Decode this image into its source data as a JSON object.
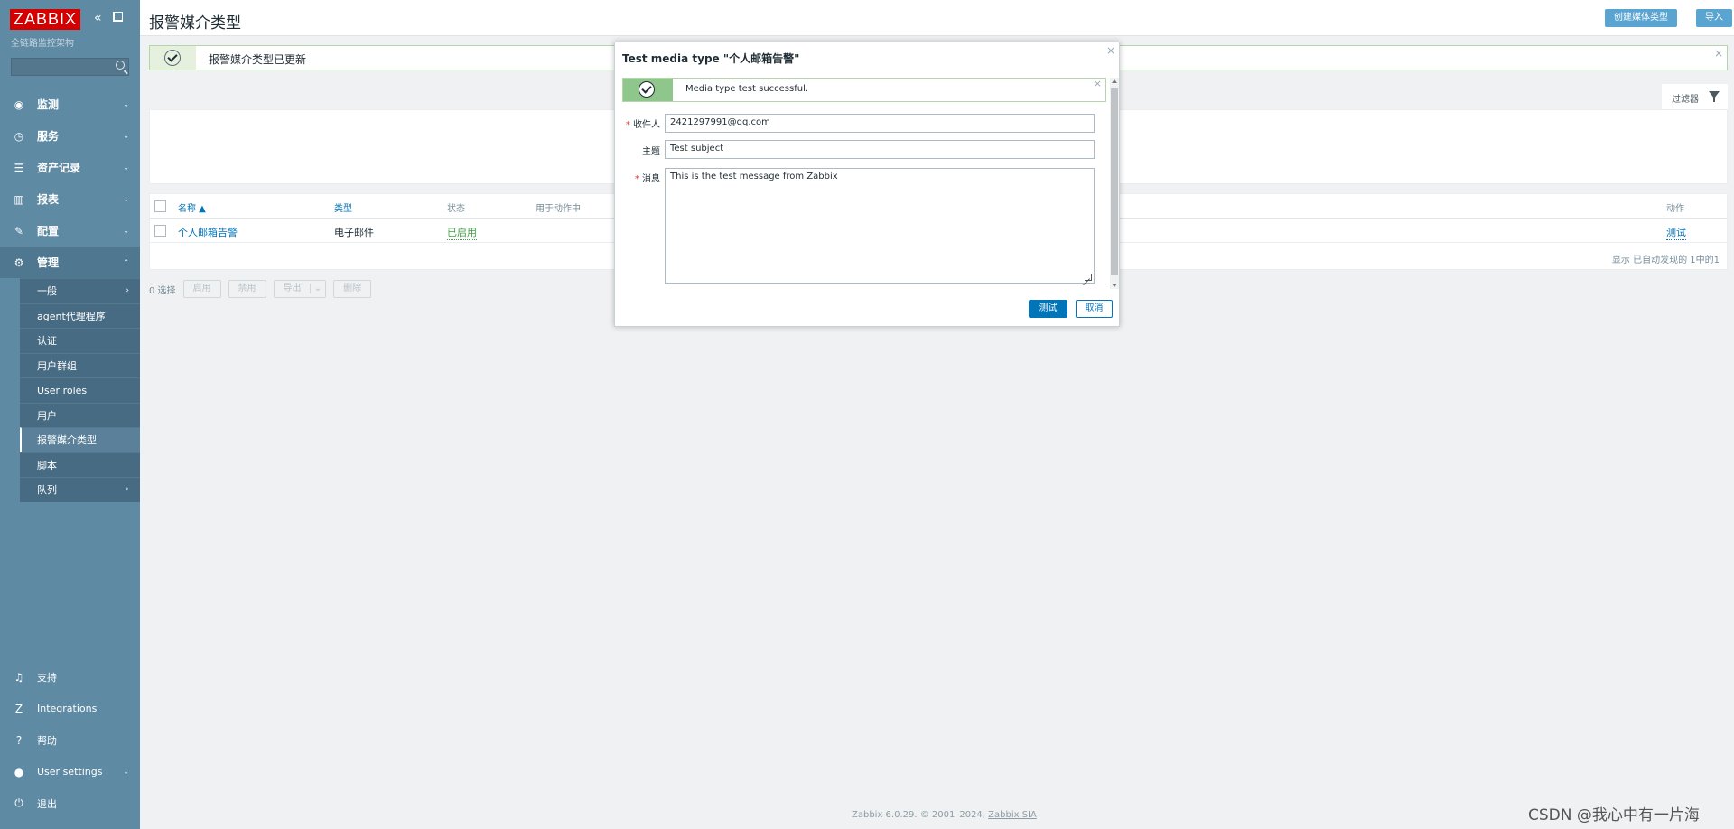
{
  "sidebar": {
    "logo": "ZABBIX",
    "server_name": "全链路监控架构",
    "nav": [
      {
        "label": "监测",
        "icon": "eye-icon",
        "glyph": "◉"
      },
      {
        "label": "服务",
        "icon": "clock-icon",
        "glyph": "◷"
      },
      {
        "label": "资产记录",
        "icon": "list-icon",
        "glyph": "☰"
      },
      {
        "label": "报表",
        "icon": "bar-chart-icon",
        "glyph": "▥"
      },
      {
        "label": "配置",
        "icon": "wrench-icon",
        "glyph": "✎"
      },
      {
        "label": "管理",
        "icon": "gear-icon",
        "glyph": "⚙"
      }
    ],
    "admin_submenu": [
      {
        "label": "一般"
      },
      {
        "label": "agent代理程序"
      },
      {
        "label": "认证"
      },
      {
        "label": "用户群组"
      },
      {
        "label": "User roles"
      },
      {
        "label": "用户"
      },
      {
        "label": "报警媒介类型"
      },
      {
        "label": "脚本"
      },
      {
        "label": "队列"
      }
    ],
    "bottom": [
      {
        "label": "支持",
        "glyph": "♫"
      },
      {
        "label": "Integrations",
        "glyph": "Z"
      },
      {
        "label": "帮助",
        "glyph": "?"
      },
      {
        "label": "User settings",
        "glyph": "●"
      },
      {
        "label": "退出",
        "glyph": "⏻"
      }
    ]
  },
  "header": {
    "title": "报警媒介类型",
    "create_button": "创建媒体类型",
    "import_button": "导入"
  },
  "banner": {
    "text": "报警媒介类型已更新",
    "close": "×"
  },
  "filter": {
    "label": "过滤器"
  },
  "table": {
    "headers": {
      "name": "名称 ▲",
      "type": "类型",
      "status": "状态",
      "used_in": "用于动作中",
      "action": "动作"
    },
    "rows": [
      {
        "name": "个人邮箱告警",
        "type": "电子邮件",
        "status": "已启用",
        "action": "测试"
      }
    ],
    "footer": "显示 已自动发现的 1中的1"
  },
  "mass_actions": {
    "selected": "0 选择",
    "enable": "启用",
    "disable": "禁用",
    "export": "导出",
    "export_chevron": "⌄",
    "delete": "删除"
  },
  "dialog": {
    "title": "Test media type \"个人邮箱告警\"",
    "close": "×",
    "message": "Media type test successful.",
    "message_close": "×",
    "fields": {
      "to_label": "收件人",
      "to_value": "2421297991@qq.com",
      "subject_label": "主题",
      "subject_value": "Test subject",
      "message_label": "消息",
      "message_value": "This is the test message from Zabbix"
    },
    "test_button": "测试",
    "cancel_button": "取消"
  },
  "footer": {
    "text": "Zabbix 6.0.29. © 2001–2024, ",
    "link": "Zabbix SIA"
  },
  "watermark": "CSDN @我心中有一片海"
}
